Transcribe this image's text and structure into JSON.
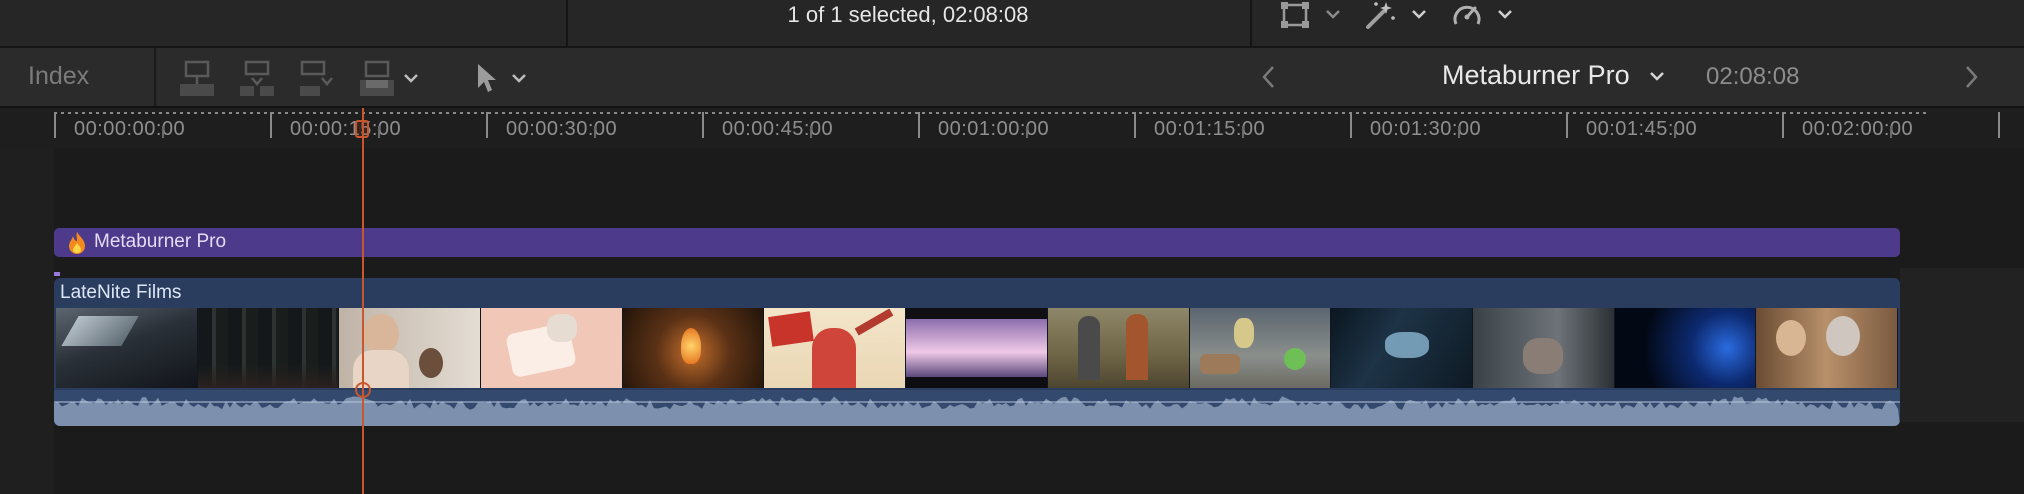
{
  "top_bar": {
    "status": "1 of 1 selected, 02:08:08",
    "icons": [
      "transform-icon",
      "chevron-down-icon",
      "magic-wand-icon",
      "chevron-down-icon",
      "speed-gauge-icon",
      "chevron-down-icon"
    ]
  },
  "toolbar": {
    "index_label": "Index",
    "edit_tools": [
      "connect-clip-icon",
      "insert-clip-icon",
      "append-clip-icon",
      "overwrite-clip-icon"
    ],
    "select_tool": "arrow-pointer-icon",
    "project_name": "Metaburner Pro",
    "project_duration": "02:08:08"
  },
  "ruler": {
    "labels": [
      "00:00:00:00",
      "00:00:15:00",
      "00:00:30:00",
      "00:00:45:00",
      "00:01:00:00",
      "00:01:15:00",
      "00:01:30:00",
      "00:01:45:00",
      "00:02:00:00"
    ]
  },
  "timeline": {
    "effect_label": "Metaburner Pro",
    "clip_label": "LateNite Films",
    "colors": {
      "effect": "#4e3a8a",
      "clip": "#2a3d5e",
      "audio": "#34496e",
      "playhead": "#c8572e"
    }
  }
}
